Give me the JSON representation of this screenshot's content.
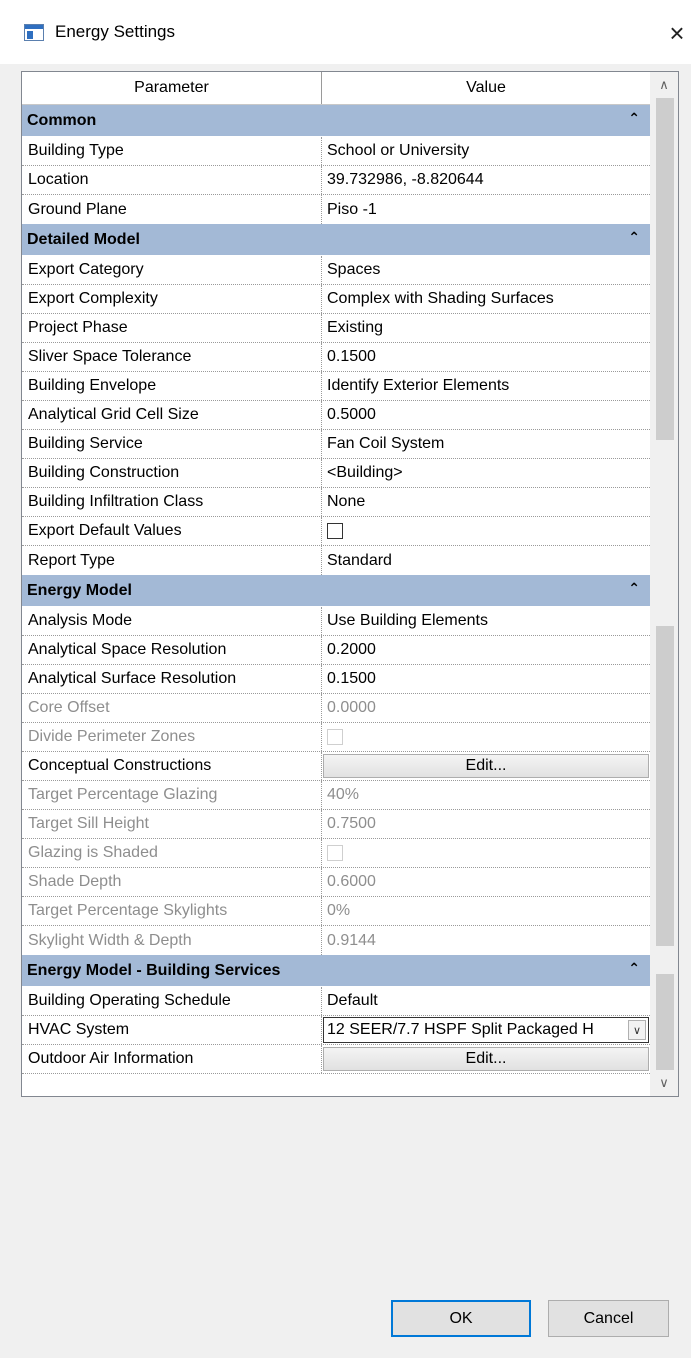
{
  "window": {
    "title": "Energy Settings",
    "close_glyph": "×",
    "icon": "revit-dialog-icon"
  },
  "grid": {
    "headers": {
      "parameter": "Parameter",
      "value": "Value"
    },
    "groups": [
      {
        "label": "Common",
        "rows": [
          {
            "param": "Building Type",
            "value": "School or University"
          },
          {
            "param": "Location",
            "value": "39.732986, -8.820644"
          },
          {
            "param": "Ground Plane",
            "value": "Piso -1"
          }
        ]
      },
      {
        "label": "Detailed Model",
        "rows": [
          {
            "param": "Export Category",
            "value": "Spaces"
          },
          {
            "param": "Export Complexity",
            "value": "Complex with Shading Surfaces"
          },
          {
            "param": "Project Phase",
            "value": "Existing"
          },
          {
            "param": "Sliver Space Tolerance",
            "value": "0.1500"
          },
          {
            "param": "Building Envelope",
            "value": "Identify Exterior Elements"
          },
          {
            "param": "Analytical Grid Cell Size",
            "value": "0.5000"
          },
          {
            "param": "Building Service",
            "value": "Fan Coil System"
          },
          {
            "param": "Building Construction",
            "value": "<Building>"
          },
          {
            "param": "Building Infiltration Class",
            "value": "None"
          },
          {
            "param": "Export Default Values",
            "value": "",
            "checked": false
          },
          {
            "param": "Report Type",
            "value": "Standard"
          }
        ]
      },
      {
        "label": "Energy Model",
        "rows": [
          {
            "param": "Analysis Mode",
            "value": "Use Building Elements"
          },
          {
            "param": "Analytical Space Resolution",
            "value": "0.2000"
          },
          {
            "param": "Analytical Surface Resolution",
            "value": "0.1500"
          },
          {
            "param": "Core Offset",
            "value": "0.0000",
            "disabled": true
          },
          {
            "param": "Divide Perimeter Zones",
            "value": "",
            "checked": false,
            "disabled": true
          },
          {
            "param": "Conceptual Constructions",
            "value": "Edit..."
          },
          {
            "param": "Target Percentage Glazing",
            "value": "40%",
            "disabled": true
          },
          {
            "param": "Target Sill Height",
            "value": "0.7500",
            "disabled": true
          },
          {
            "param": "Glazing is Shaded",
            "value": "",
            "checked": false,
            "disabled": true
          },
          {
            "param": "Shade Depth",
            "value": "0.6000",
            "disabled": true
          },
          {
            "param": "Target Percentage Skylights",
            "value": "0%",
            "disabled": true
          },
          {
            "param": "Skylight Width & Depth",
            "value": "0.9144",
            "disabled": true
          }
        ]
      },
      {
        "label": "Energy Model - Building Services",
        "rows": [
          {
            "param": "Building Operating Schedule",
            "value": "Default"
          },
          {
            "param": "HVAC System",
            "value": "12 SEER/7.7 HSPF Split Packaged H"
          },
          {
            "param": "Outdoor Air Information",
            "value": "Edit..."
          }
        ]
      }
    ]
  },
  "buttons": {
    "ok": "OK",
    "cancel": "Cancel"
  },
  "colors": {
    "group_header_bg": "#a3b9d6",
    "ok_border": "#0078d7",
    "disabled_text": "#8e8e8e"
  }
}
